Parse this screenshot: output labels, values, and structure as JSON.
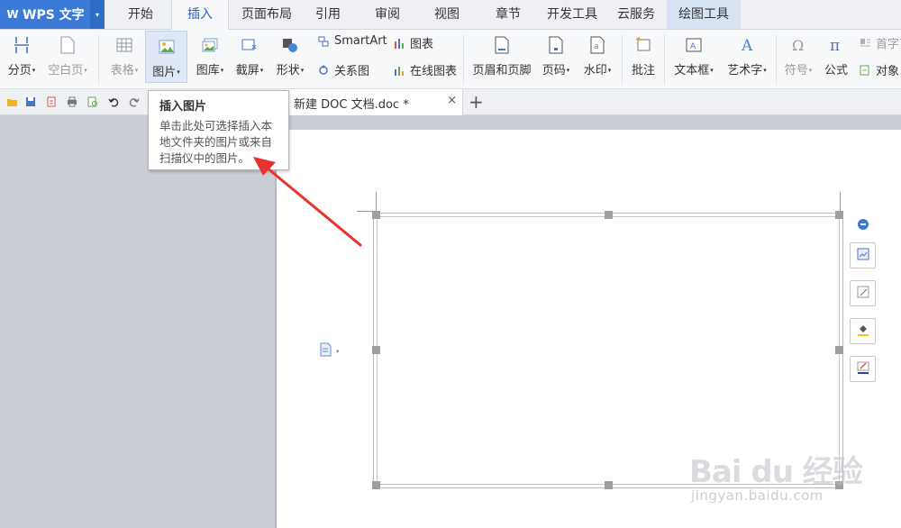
{
  "app": {
    "logo_text": "W",
    "title": "WPS 文字",
    "menu_arrow": "▾"
  },
  "tabs": [
    {
      "label": "开始"
    },
    {
      "label": "插入",
      "active": true
    },
    {
      "label": "页面布局"
    },
    {
      "label": "引用"
    },
    {
      "label": "审阅"
    },
    {
      "label": "视图"
    },
    {
      "label": "章节"
    },
    {
      "label": "开发工具"
    },
    {
      "label": "云服务"
    },
    {
      "label": "绘图工具"
    }
  ],
  "ribbon": {
    "page_break": "分页",
    "blank_page": "空白页",
    "table": "表格",
    "picture": "图片",
    "gallery": "图库",
    "screenshot": "截屏",
    "shape": "形状",
    "smartart": "SmartArt",
    "chart": "图表",
    "relation": "关系图",
    "online_chart": "在线图表",
    "header_footer": "页眉和页脚",
    "page_number": "页码",
    "watermark": "水印",
    "comment": "批注",
    "textbox": "文本框",
    "wordart": "艺术字",
    "symbol": "符号",
    "formula": "公式",
    "dropcap": "首字下",
    "object": "对象",
    "dropdown_arrow": "▾"
  },
  "document": {
    "tab_name": "新建 DOC 文档.doc *",
    "close": "×",
    "new_tab": "+"
  },
  "tooltip": {
    "title": "插入图片",
    "line1": "单击此处可选择插入本",
    "line2": "地文件夹的图片或来自",
    "line3": "扫描仪中的图片。"
  },
  "watermark": {
    "logo": "Bai du 经验",
    "url": "jingyan.baidu.com"
  },
  "colors": {
    "accent": "#3b7ad6",
    "arrow": "#e8322c",
    "handle": "#9e9e9e"
  }
}
